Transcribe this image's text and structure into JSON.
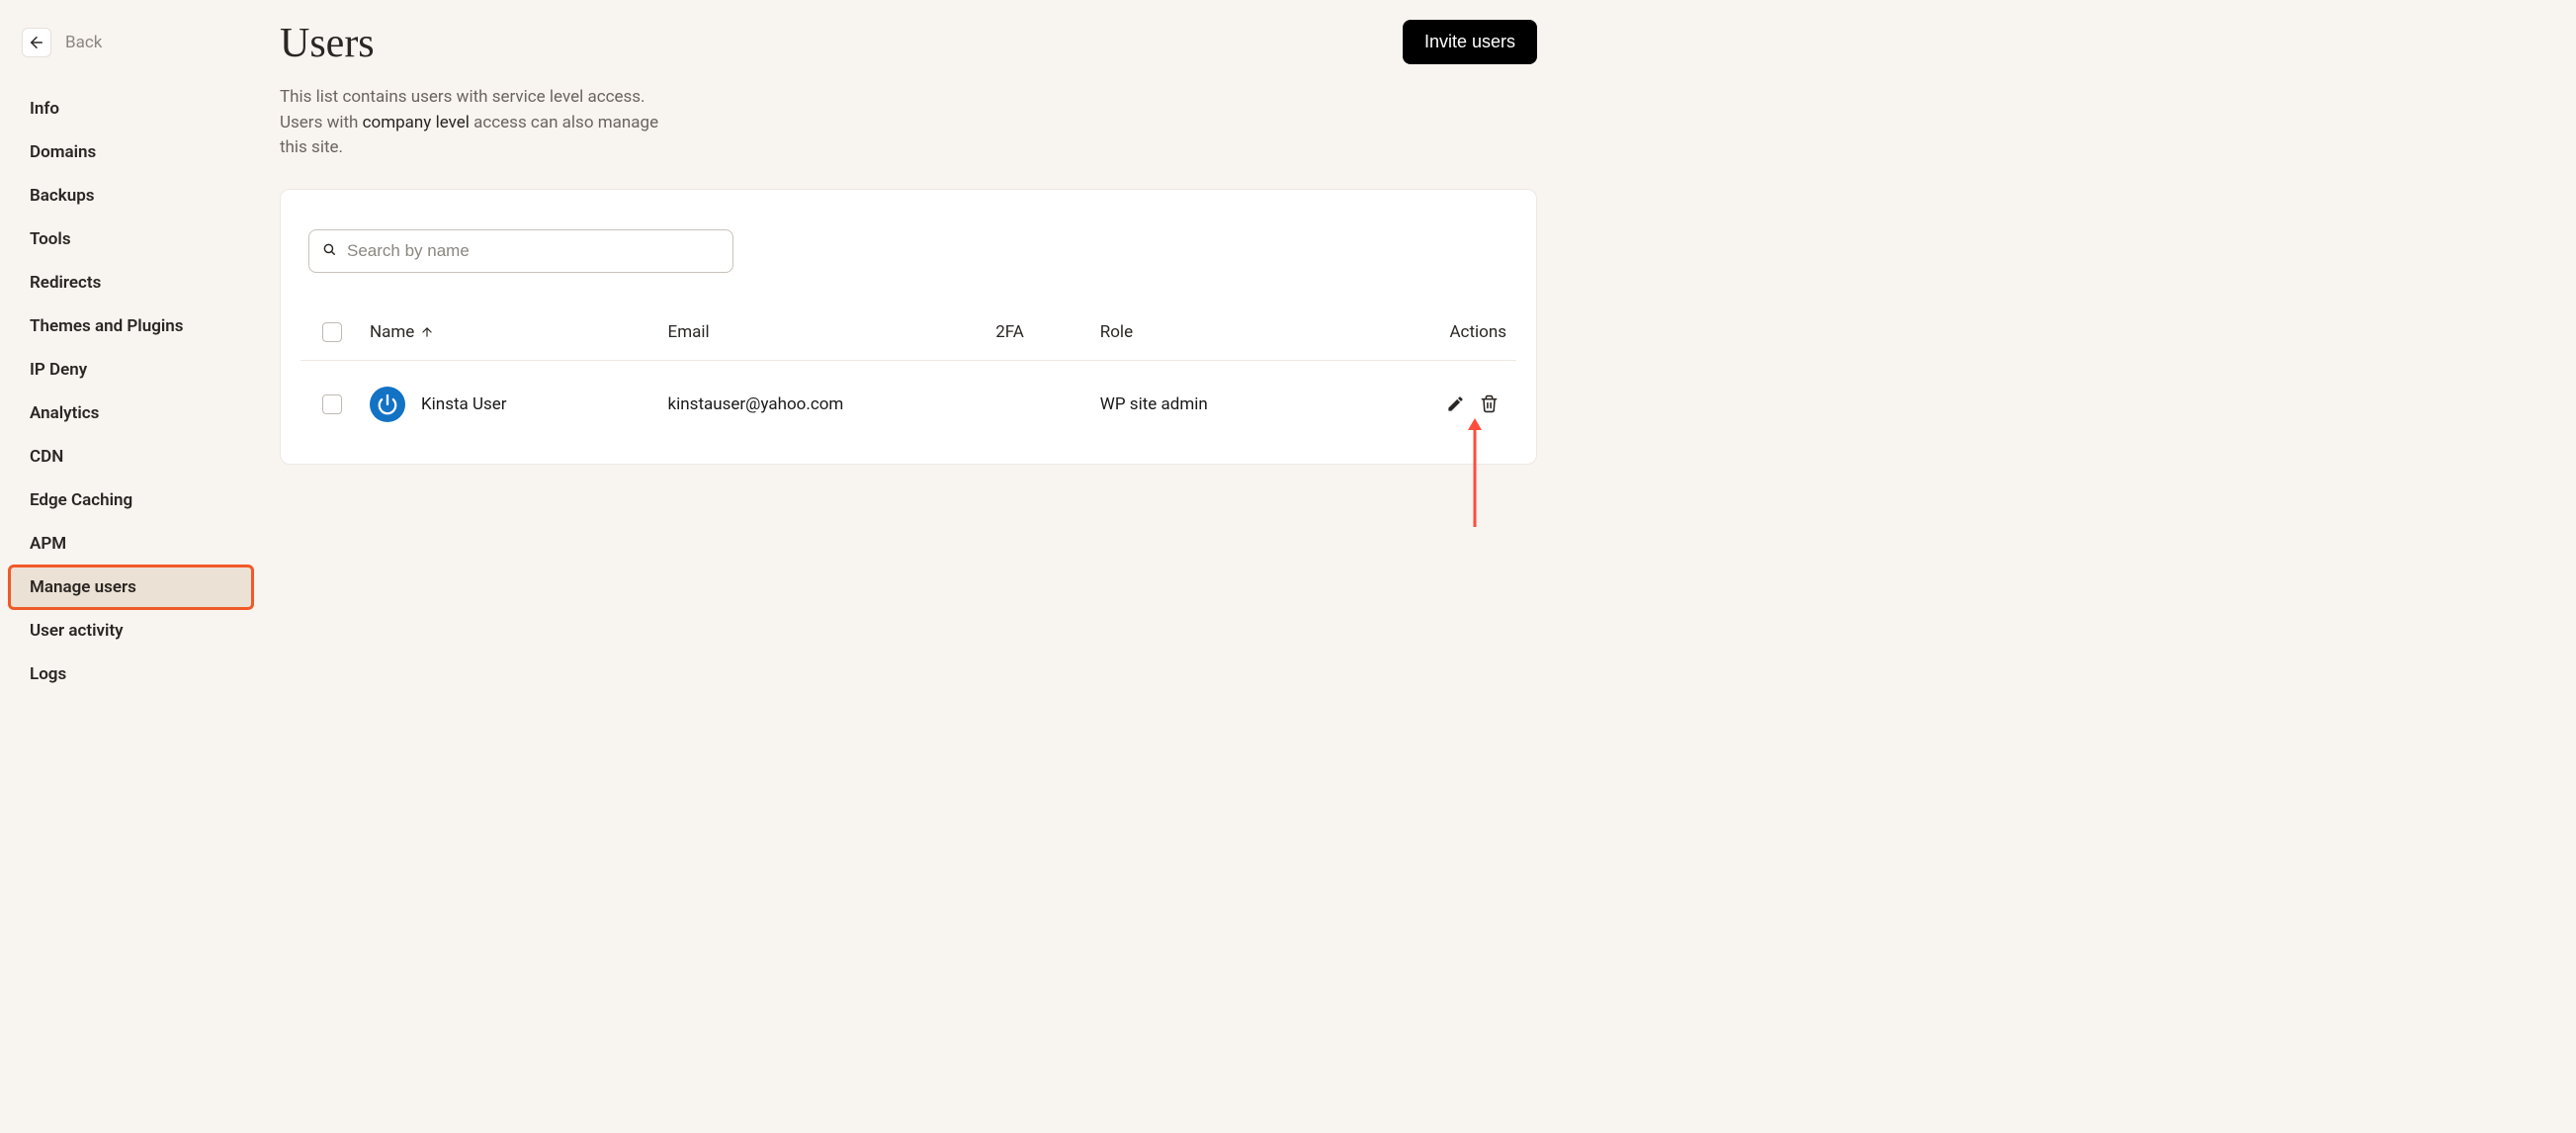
{
  "back": {
    "label": "Back"
  },
  "sidebar": {
    "items": [
      {
        "label": "Info",
        "active": false
      },
      {
        "label": "Domains",
        "active": false
      },
      {
        "label": "Backups",
        "active": false
      },
      {
        "label": "Tools",
        "active": false
      },
      {
        "label": "Redirects",
        "active": false
      },
      {
        "label": "Themes and Plugins",
        "active": false
      },
      {
        "label": "IP Deny",
        "active": false
      },
      {
        "label": "Analytics",
        "active": false
      },
      {
        "label": "CDN",
        "active": false
      },
      {
        "label": "Edge Caching",
        "active": false
      },
      {
        "label": "APM",
        "active": false
      },
      {
        "label": "Manage users",
        "active": true
      },
      {
        "label": "User activity",
        "active": false
      },
      {
        "label": "Logs",
        "active": false
      }
    ]
  },
  "header": {
    "title": "Users",
    "invite_label": "Invite users"
  },
  "description": {
    "part1": "This list contains users with service level access. Users with ",
    "link": "company level",
    "part2": " access can also manage this site."
  },
  "search": {
    "placeholder": "Search by name",
    "value": ""
  },
  "table": {
    "headers": {
      "name": "Name",
      "email": "Email",
      "twofa": "2FA",
      "role": "Role",
      "actions": "Actions"
    },
    "rows": [
      {
        "name": "Kinsta User",
        "email": "kinstauser@yahoo.com",
        "twofa": "",
        "role": "WP site admin"
      }
    ]
  }
}
